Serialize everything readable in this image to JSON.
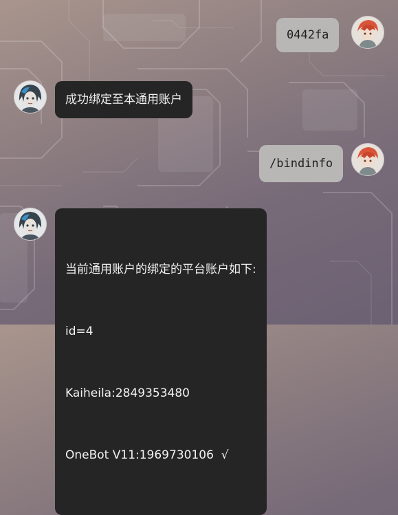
{
  "messages": [
    {
      "sender": "user",
      "text": "0442fa"
    },
    {
      "sender": "bot",
      "text": "成功绑定至本通用账户"
    },
    {
      "sender": "user",
      "text": "/bindinfo"
    },
    {
      "sender": "bot",
      "lines": [
        "当前通用账户的绑定的平台账户如下:",
        "id=4",
        "Kaiheila:2849353480",
        "OneBot V11:1969730106  √"
      ]
    }
  ],
  "colors": {
    "bot_bubble": "#252525",
    "user_bubble": "#b9b6b6",
    "bot_text": "#f2f2f2",
    "user_text": "#1f1f1f"
  },
  "icons": {
    "user_avatar": "red-haired-user-avatar",
    "bot_avatar": "blue-haired-bot-avatar"
  }
}
